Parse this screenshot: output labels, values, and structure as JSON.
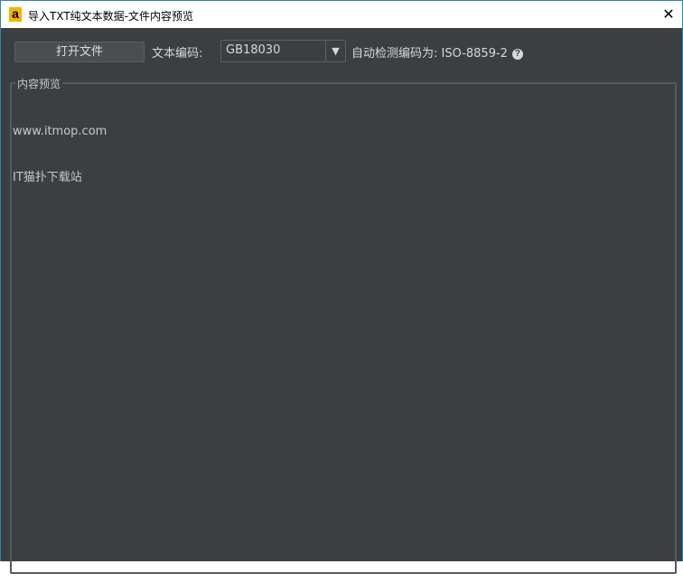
{
  "window": {
    "title": "导入TXT纯文本数据-文件内容预览",
    "logo": "a",
    "close_icon": "close-icon"
  },
  "toolbar": {
    "open_label": "打开文件",
    "encoding_label": "文本编码:",
    "encoding_value": "GB18030",
    "detected_label": "自动检测编码为: ISO-8859-2",
    "help_icon": "question-circle-icon"
  },
  "preview": {
    "label": "内容预览",
    "lines": [
      "www.itmop.com",
      "IT猫扑下载站"
    ]
  },
  "colors": {
    "background": "#3b3f42",
    "border": "#2b8aa0"
  }
}
